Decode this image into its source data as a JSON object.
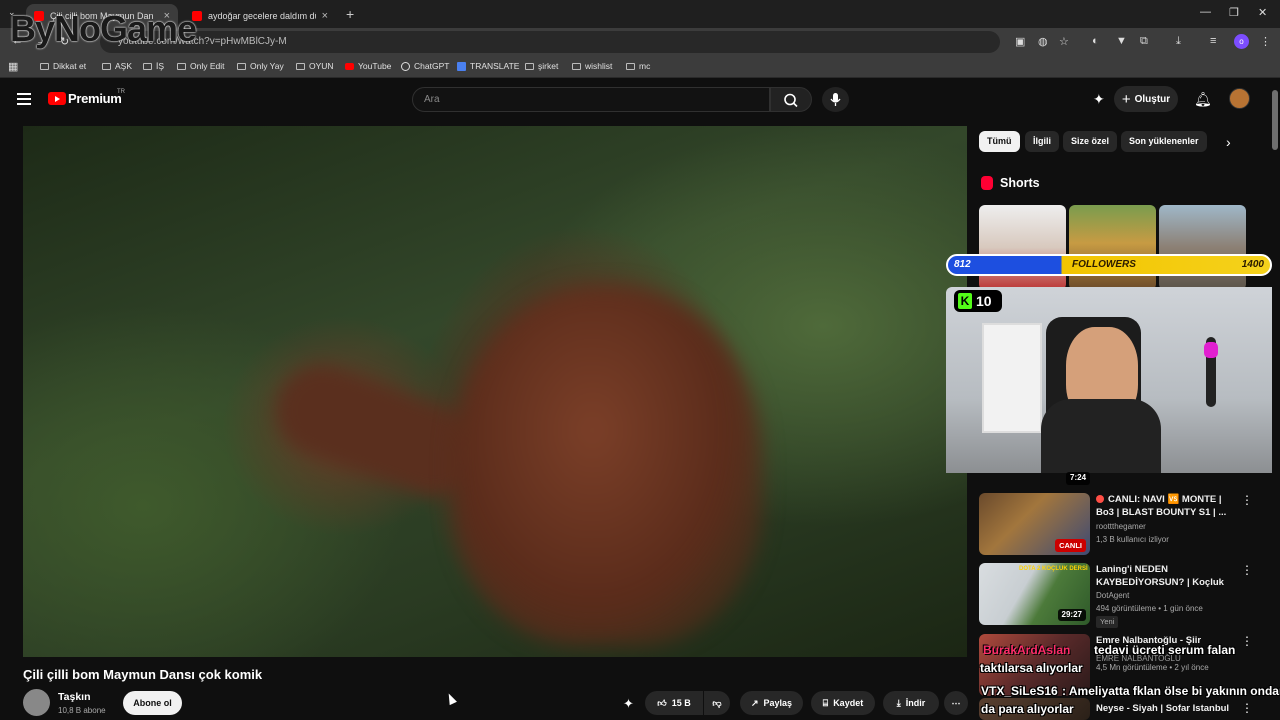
{
  "browser": {
    "tabs": [
      {
        "title": "Çili cilli bom Maymun Dan"
      },
      {
        "title": "aydoğar gecelere daldım düşü"
      }
    ],
    "url": "youtube.com/watch?v=pHwMBlCJy-M",
    "profile_initial": "o",
    "bookmarks": [
      "Dikkat et",
      "AŞK",
      "İŞ",
      "Only Edit",
      "Only Yay",
      "OYUN",
      "YouTube",
      "ChatGPT",
      "TRANSLATE",
      "şirket",
      "wishlist",
      "mc"
    ]
  },
  "watermark": "ByNoGame",
  "masthead": {
    "brand": "Premium",
    "region": "TR",
    "search_placeholder": "Ara",
    "create_label": "Oluştur"
  },
  "video": {
    "title": "Çili çilli bom Maymun Dansı çok komik",
    "channel": "Taşkın",
    "subscribers": "10,8 B abone",
    "subscribe_label": "Abone ol",
    "likes": "15 B",
    "share_label": "Paylaş",
    "save_label": "Kaydet",
    "download_label": "İndir"
  },
  "chips": [
    "Tümü",
    "İlgili",
    "Size özel",
    "Son yüklenenler"
  ],
  "shorts": {
    "label": "Shorts"
  },
  "stream_overlay": {
    "followers_current": "812",
    "followers_label": "FOLLOWERS",
    "followers_goal": "1400",
    "kick_count": "10",
    "alert_name": "BurakArdAslan",
    "alert_action": "taktılarsa alıyorlar",
    "alert_user2": "VTX_SiLeS16",
    "alert_msg2": ": Ameliyatta fklan ölse bi yakının ondan",
    "alert_msg2b": "da para alıyorlar",
    "alert_msg1": "tedavi ücreti serum falan"
  },
  "floating_duration": "7:24",
  "recommendations": [
    {
      "title": "CANLI: NAVI 🆚 MONTE | Bo3 | BLAST BOUNTY S1 | ...",
      "channel": "roottthegamer",
      "meta": "1,3 B kullanıcı izliyor",
      "live_label": "CANLI",
      "is_live": true
    },
    {
      "title": "Laning'i NEDEN KAYBEDİYORSUN? | Koçluk ...",
      "channel": "DotAgent",
      "meta": "494 görüntüleme • 1 gün önce",
      "duration": "29:27",
      "badge": "Yeni",
      "thumb_text": "DOTA 2 KOÇLUK DERSİ"
    },
    {
      "title": "Emre Nalbantoğlu - Şiir Oldum",
      "channel": "EMRE NALBANTOĞLU",
      "meta": "4,5 Mn görüntüleme • 2 yıl önce"
    },
    {
      "title": "Neyse - Siyah | Sofar Istanbul"
    }
  ]
}
